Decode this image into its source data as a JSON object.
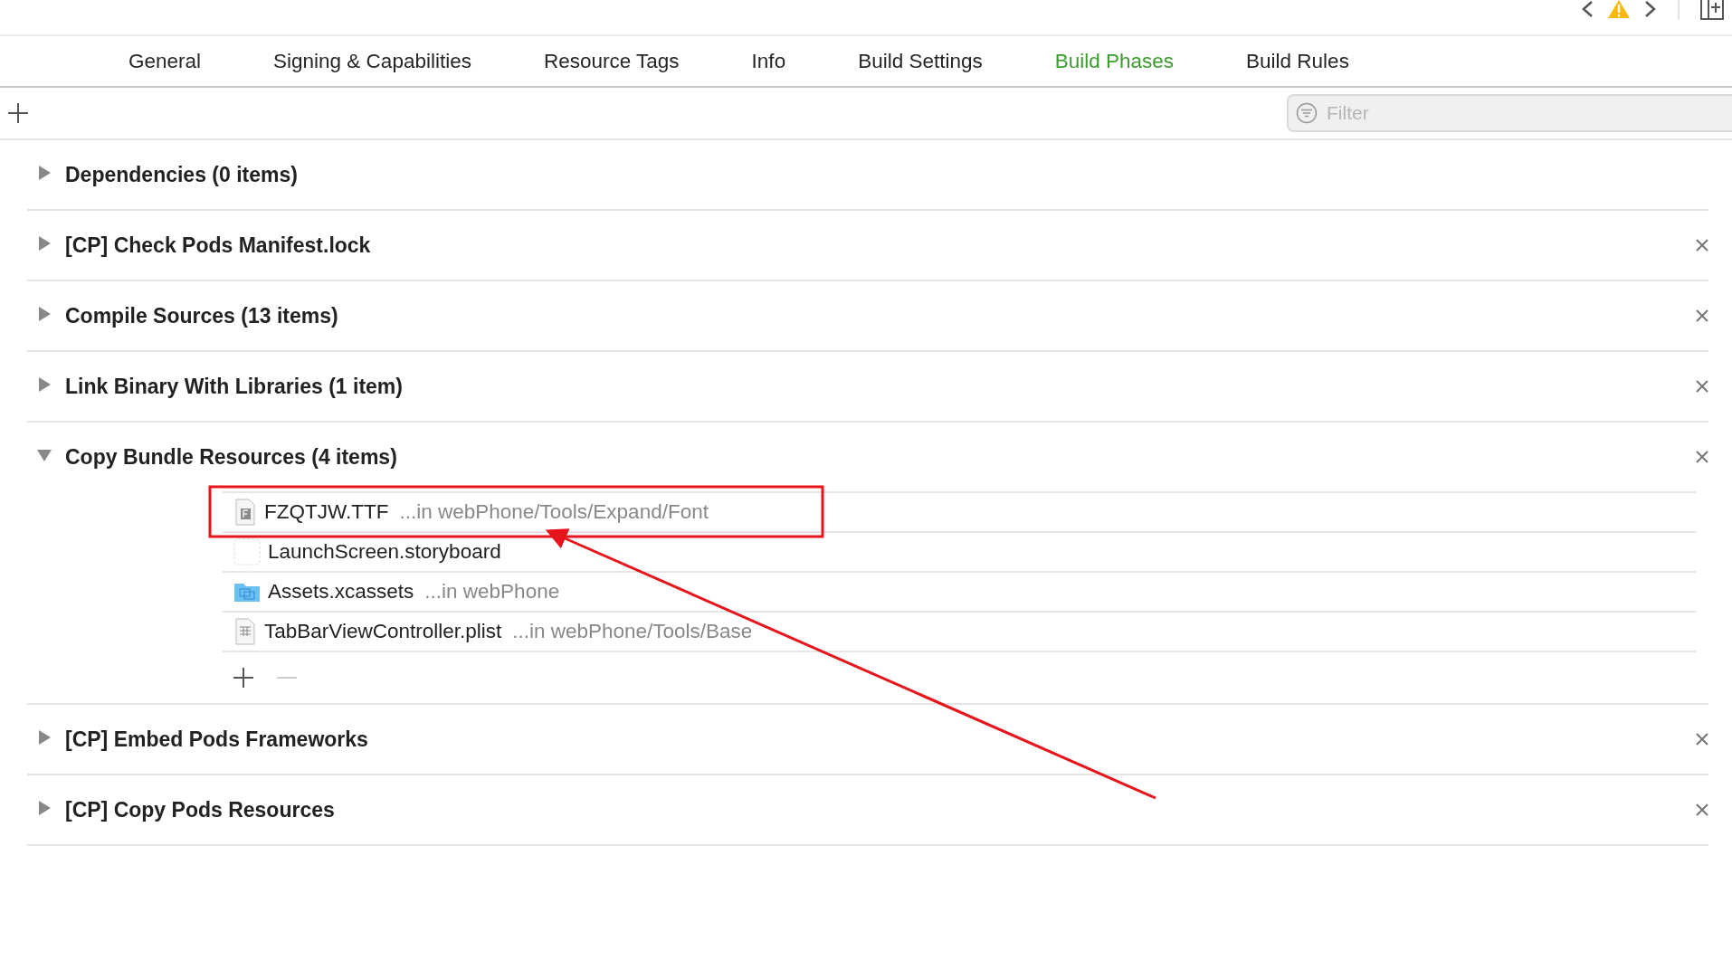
{
  "tabs": [
    {
      "label": "General",
      "selected": false
    },
    {
      "label": "Signing & Capabilities",
      "selected": false
    },
    {
      "label": "Resource Tags",
      "selected": false
    },
    {
      "label": "Info",
      "selected": false
    },
    {
      "label": "Build Settings",
      "selected": false
    },
    {
      "label": "Build Phases",
      "selected": true
    },
    {
      "label": "Build Rules",
      "selected": false
    }
  ],
  "filter": {
    "placeholder": "Filter"
  },
  "phases": [
    {
      "title": "Dependencies (0 items)",
      "expanded": false,
      "removable": false
    },
    {
      "title": "[CP] Check Pods Manifest.lock",
      "expanded": false,
      "removable": true
    },
    {
      "title": "Compile Sources (13 items)",
      "expanded": false,
      "removable": true
    },
    {
      "title": "Link Binary With Libraries (1 item)",
      "expanded": false,
      "removable": true
    },
    {
      "title": "Copy Bundle Resources (4 items)",
      "expanded": true,
      "removable": true,
      "files": [
        {
          "kind": "font",
          "name": "FZQTJW.TTF",
          "location": "...in webPhone/Tools/Expand/Font"
        },
        {
          "kind": "storyboard",
          "name": "LaunchScreen.storyboard"
        },
        {
          "kind": "folder",
          "name": "Assets.xcassets",
          "location": "...in webPhone"
        },
        {
          "kind": "plist",
          "name": "TabBarViewController.plist",
          "location": "...in webPhone/Tools/Base"
        }
      ]
    },
    {
      "title": "[CP] Embed Pods Frameworks",
      "expanded": false,
      "removable": true
    },
    {
      "title": "[CP] Copy Pods Resources",
      "expanded": false,
      "removable": true
    }
  ]
}
